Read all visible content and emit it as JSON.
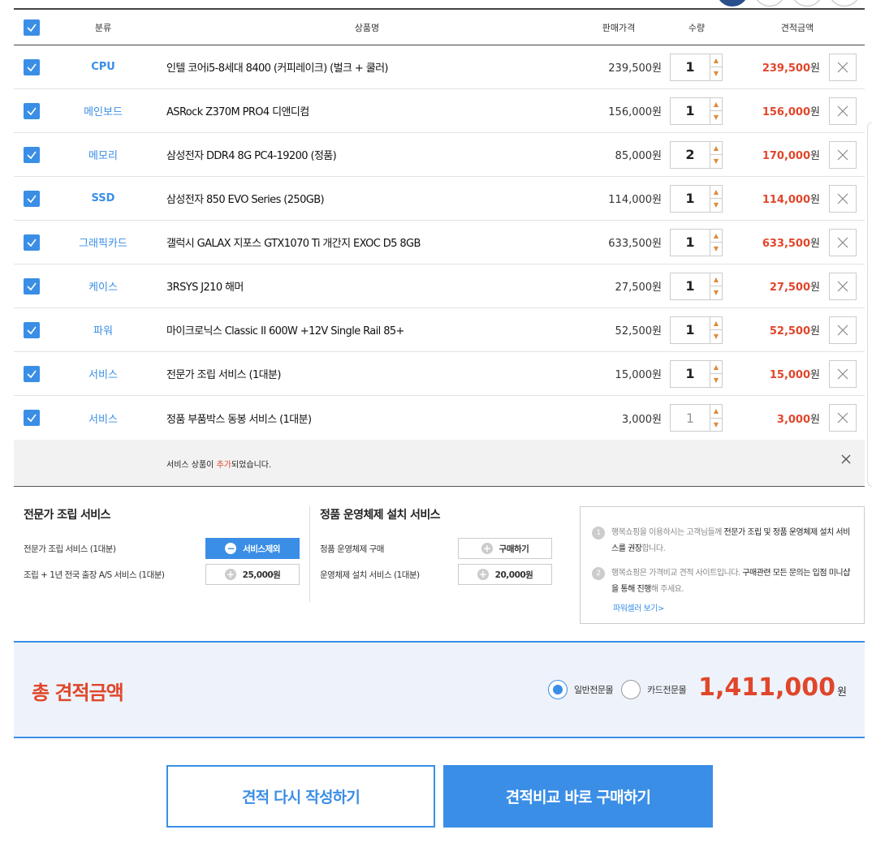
{
  "header": {
    "category": "분류",
    "product": "상품명",
    "price": "판매가격",
    "qty": "수량",
    "total": "견적금액"
  },
  "items": [
    {
      "category": "CPU",
      "name": "인텔 코어i5-8세대 8400 (커피레이크) (벌크 + 쿨러)",
      "price": "239,500원",
      "qty": "1",
      "total": "239,500",
      "won": "원"
    },
    {
      "category": "메인보드",
      "name": "ASRock Z370M PRO4 디앤디컴",
      "price": "156,000원",
      "qty": "1",
      "total": "156,000",
      "won": "원"
    },
    {
      "category": "메모리",
      "name": "삼성전자 DDR4 8G PC4-19200 (정품)",
      "price": "85,000원",
      "qty": "2",
      "total": "170,000",
      "won": "원"
    },
    {
      "category": "SSD",
      "name": "삼성전자 850 EVO Series (250GB)",
      "price": "114,000원",
      "qty": "1",
      "total": "114,000",
      "won": "원"
    },
    {
      "category": "그래픽카드",
      "name": "갤럭시 GALAX 지포스 GTX1070 Ti 개간지 EXOC D5 8GB",
      "price": "633,500원",
      "qty": "1",
      "total": "633,500",
      "won": "원"
    },
    {
      "category": "케이스",
      "name": "3RSYS J210 해머",
      "price": "27,500원",
      "qty": "1",
      "total": "27,500",
      "won": "원"
    },
    {
      "category": "파워",
      "name": "마이크로닉스 Classic II 600W +12V Single Rail 85+",
      "price": "52,500원",
      "qty": "1",
      "total": "52,500",
      "won": "원"
    },
    {
      "category": "서비스",
      "name": "전문가 조립 서비스 (1대분)",
      "price": "15,000원",
      "qty": "1",
      "total": "15,000",
      "won": "원"
    },
    {
      "category": "서비스",
      "name": "정품 부품박스 동봉 서비스 (1대분)",
      "price": "3,000원",
      "qty": "1",
      "total": "3,000",
      "won": "원"
    }
  ],
  "notice": {
    "pre": "서비스 상품이 ",
    "highlight": "추가",
    "post": "되었습니다."
  },
  "assembly": {
    "title": "전문가 조립 서비스",
    "line1_label": "전문가 조립 서비스 (1대분)",
    "line1_button": "서비스제외",
    "line2_label": "조립 + 1년 전국 출장 A/S 서비스 (1대분)",
    "line2_button": "25,000원"
  },
  "os": {
    "title": "정품 운영체제 설치 서비스",
    "line1_label": "정품 운영체제 구매",
    "line1_button": "구매하기",
    "line2_label": "운영체제 설치 서비스 (1대분)",
    "line2_button": "20,000원"
  },
  "info": {
    "n1": "1",
    "t1a": "행복쇼핑을 이용하시는 고객님들께 ",
    "t1b": "전문가 조립 및 정품 운영체제 설치 서비스를 권장",
    "t1c": "합니다.",
    "n2": "2",
    "t2a": "행복쇼핑은 가격비교 견적 사이트입니다. ",
    "t2b": "구매관련 모든 문의는 입점 미니샵을 통해 진행",
    "t2c": "해 주세요.",
    "link": "파워셀러 보기>"
  },
  "summary": {
    "label": "총 견적금액",
    "option1": "일반전문몰",
    "option2": "카드전문몰",
    "amount": "1,411,000",
    "won": "원"
  },
  "actions": {
    "reset": "견적 다시 작성하기",
    "buy": "견적비교 바로 구매하기"
  },
  "colors": {
    "accent": "#3a8ee6",
    "total_red": "#e0462b"
  }
}
